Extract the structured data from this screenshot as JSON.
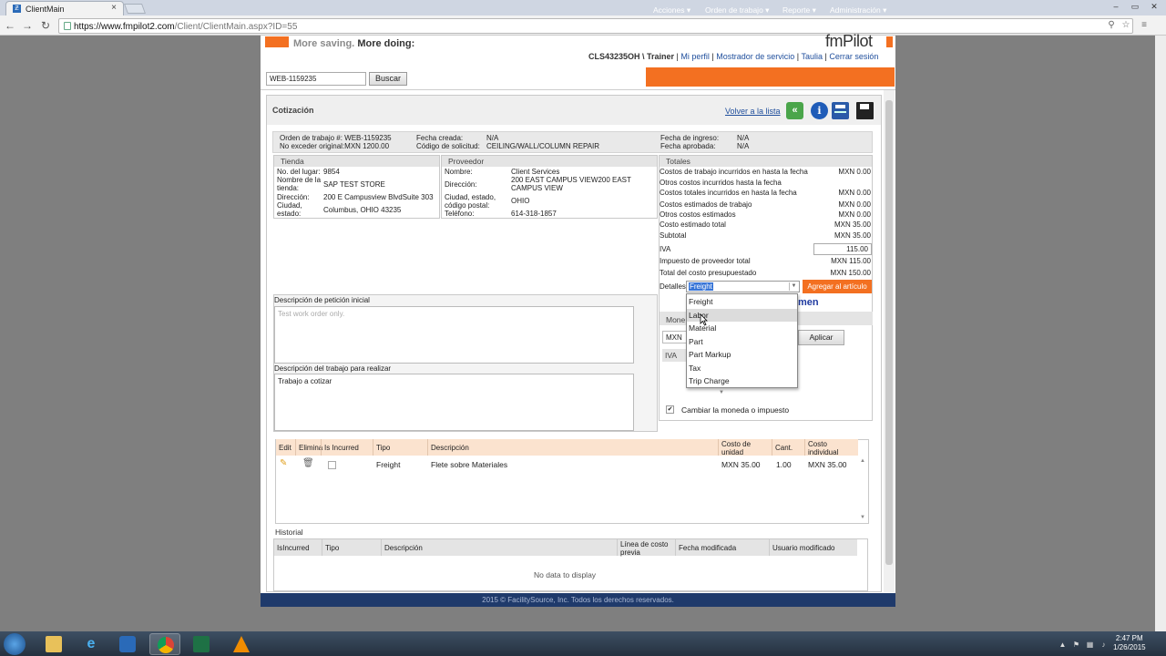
{
  "browser": {
    "tab_title": "ClientMain",
    "url_host": "https://www.fmpilot2.com",
    "url_path": "/Client/ClientMain.aspx?ID=55"
  },
  "header": {
    "tagline_a": "More saving.",
    "tagline_b": "More doing:",
    "brand": "fmPilot",
    "user": "CLS43235OH \\ Trainer",
    "links": [
      "Mi perfil",
      "Mostrador de servicio",
      "Taulia",
      "Cerrar sesión"
    ],
    "search_value": "WEB-1159235",
    "search_button": "Buscar",
    "menu": [
      "Acciones",
      "Orden de trabajo",
      "Reporte",
      "Administración"
    ]
  },
  "panel": {
    "title": "Cotización",
    "back_link": "Volver a la lista"
  },
  "info": {
    "wo_label": "Orden de trabajo #:",
    "wo_value": "WEB-1159235",
    "nte_label": "No exceder original:",
    "nte_value": "MXN 1200.00",
    "created_label": "Fecha creada:",
    "created_value": "N/A",
    "req_code_label": "Código de solicitud:",
    "req_code_value": "CEILING/WALL/COLUMN REPAIR",
    "entry_label": "Fecha de ingreso:",
    "entry_value": "N/A",
    "approved_label": "Fecha aprobada:",
    "approved_value": "N/A"
  },
  "store": {
    "header": "Tienda",
    "place_label": "No. del lugar:",
    "place_value": "9854",
    "name_label_1": "Nombre de la",
    "name_label_2": "tienda:",
    "name_value": "SAP TEST STORE",
    "addr_label": "Dirección:",
    "addr_value": "200 E Campusview BlvdSuite 303",
    "city_label_1": "Ciudad,",
    "city_label_2": "estado:",
    "city_value": "Columbus, OHIO 43235"
  },
  "provider": {
    "header": "Proveedor",
    "name_label": "Nombre:",
    "name_value": "Client Services",
    "addr_label": "Dirección:",
    "addr_value_1": "200 EAST CAMPUS VIEW200 EAST",
    "addr_value_2": "CAMPUS VIEW",
    "city_label_1": "Ciudad, estado,",
    "city_label_2": "código postal:",
    "city_value": "OHIO",
    "phone_label": "Teléfono:",
    "phone_value": "614-318-1857"
  },
  "totals": {
    "header": "Totales",
    "rows": [
      {
        "label": "Costos de trabajo incurridos en hasta la fecha",
        "value": "MXN 0.00"
      },
      {
        "label": "Otros costos incurridos hasta la fecha",
        "value": ""
      },
      {
        "label": "Costos totales incurridos en hasta la fecha",
        "value": "MXN 0.00"
      },
      {
        "label": "Costos estimados de trabajo",
        "value": "MXN 0.00"
      },
      {
        "label": "Otros costos estimados",
        "value": "MXN 0.00"
      },
      {
        "label": "Costo estimado total",
        "value": "MXN 35.00"
      },
      {
        "label": "Subtotal",
        "value": "MXN 35.00"
      }
    ],
    "iva_label": "IVA",
    "iva_value": "115.00",
    "tax_label": "Impuesto de proveedor total",
    "tax_value": "MXN 115.00",
    "budget_label": "Total del costo presupuestado",
    "budget_value": "MXN 150.00",
    "details_label": "Detalles",
    "details_selected": "Freight",
    "add_button": "Agregar al artículo",
    "resumen_partial": "men",
    "currency_section": "Mone",
    "currency_value": "MXN",
    "iva_section": "IVA",
    "apply_button": "Aplicar",
    "change_currency_label": "Cambiar la moneda o impuesto",
    "change_currency_checked": true
  },
  "dropdown": {
    "options": [
      "Freight",
      "Labor",
      "Material",
      "Part",
      "Part Markup",
      "Tax",
      "Trip Charge"
    ],
    "highlighted": "Labor"
  },
  "descriptions": {
    "initial_label": "Descripción de petición inicial",
    "initial_placeholder": "Test work order only.",
    "work_label": "Descripción del trabajo para realizar",
    "work_value": "Trabajo a cotizar"
  },
  "grid": {
    "headers": [
      "Edit",
      "Elimina",
      "Is Incurred",
      "Tipo",
      "Descripción",
      "Costo de unidad",
      "Cant.",
      "Costo individual"
    ],
    "rows": [
      {
        "is_incurred": false,
        "type": "Freight",
        "description": "Flete sobre Materiales",
        "unit_cost": "MXN 35.00",
        "qty": "1.00",
        "total": "MXN 35.00"
      }
    ]
  },
  "history": {
    "title": "Historial",
    "headers": [
      "IsIncurred",
      "Tipo",
      "Descripción",
      "Línea de costo previa",
      "Fecha modificada",
      "Usuario modificado"
    ],
    "empty": "No data to display"
  },
  "footer": "2015 © FacilitySource, Inc. Todos los derechos reservados.",
  "taskbar": {
    "time": "2:47 PM",
    "date": "1/26/2015"
  },
  "colors": {
    "accent": "#f37021",
    "link": "#1f4e9c",
    "footer_bg": "#1f3a6b"
  }
}
